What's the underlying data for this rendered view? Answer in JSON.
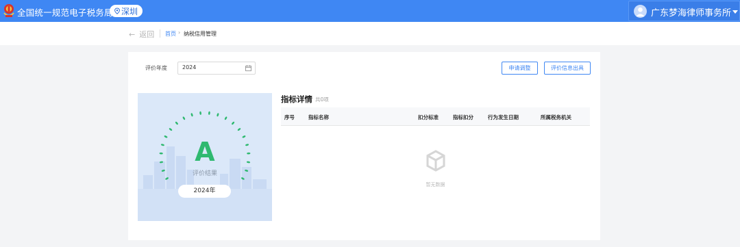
{
  "header": {
    "title": "全国统一规范电子税务局",
    "city": "深圳",
    "user_name": "广东梦海律师事务所"
  },
  "breadcrumb": {
    "back_label": "返回",
    "back_arrow": "←",
    "home": "首页",
    "separator": "›",
    "current": "纳税信用管理"
  },
  "filter": {
    "year_label": "评价年度",
    "year_value": "2024"
  },
  "actions": {
    "apply_adjust": "申请调整",
    "issue_info": "评价信息出具"
  },
  "result": {
    "grade": "A",
    "caption": "评价结果",
    "year": "2024年",
    "grade_color": "#2fb970"
  },
  "detail": {
    "title": "指标详情",
    "count": "共0项",
    "columns": [
      "序号",
      "指标名称",
      "扣分标准",
      "指标扣分",
      "行为发生日期",
      "所属税务机关"
    ],
    "rows": [],
    "empty_text": "暂无数据"
  },
  "colors": {
    "primary": "#3f87f3",
    "grade_green": "#2fb970"
  },
  "icons": {
    "logo": "tax-emblem-icon",
    "city": "location-pin-icon",
    "avatar": "user-avatar-icon",
    "dropdown": "caret-down-icon",
    "calendar": "calendar-icon",
    "empty": "empty-box-icon"
  }
}
